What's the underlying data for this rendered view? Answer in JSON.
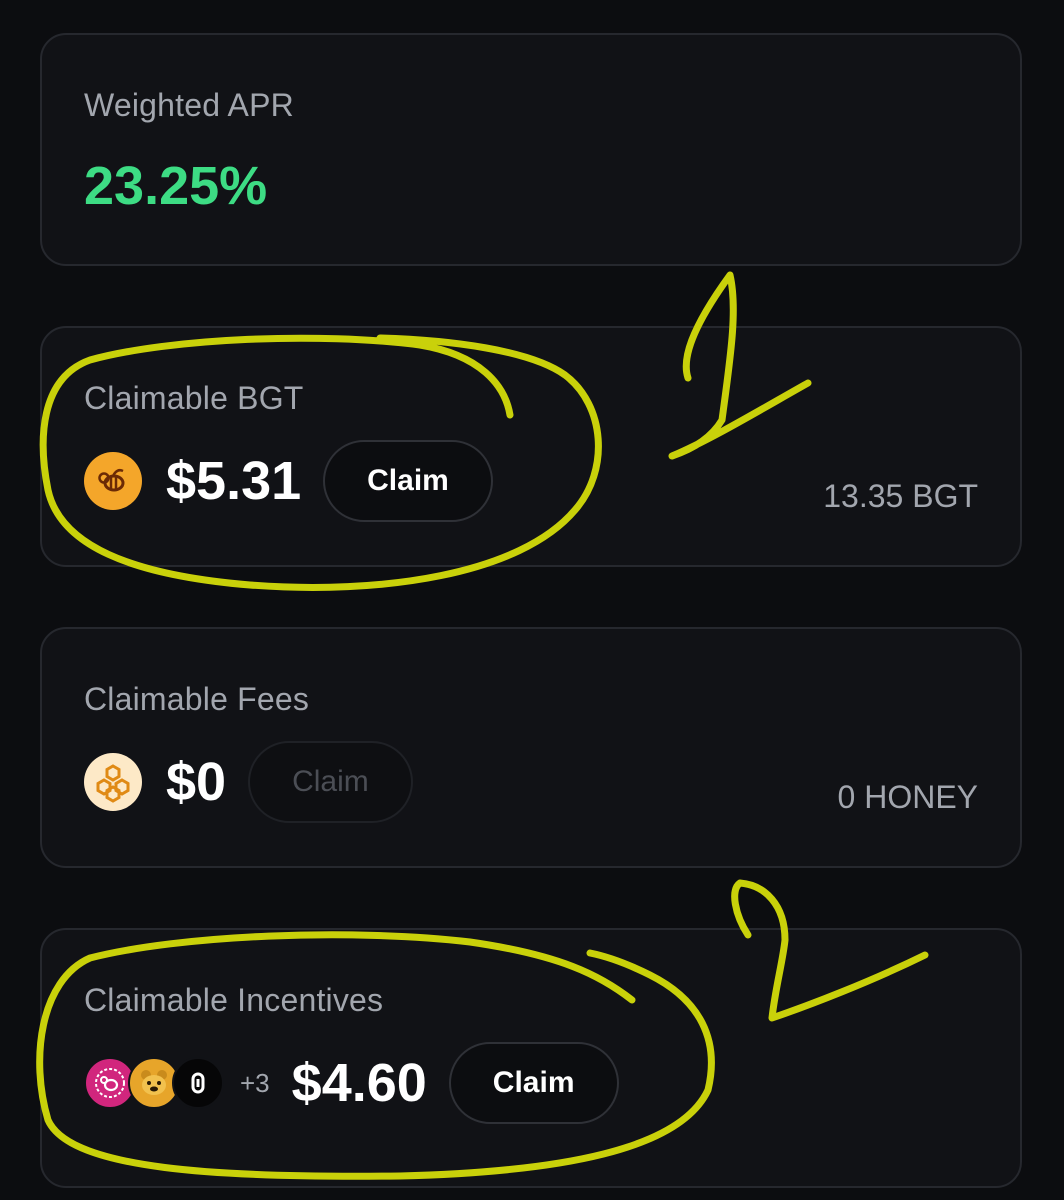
{
  "apr": {
    "label": "Weighted APR",
    "value": "23.25%"
  },
  "bgt": {
    "label": "Claimable BGT",
    "icon": "bgt-bee-icon",
    "amount": "$5.31",
    "claim_label": "Claim",
    "balance": "13.35 BGT"
  },
  "fees": {
    "label": "Claimable Fees",
    "icon": "honeycomb-icon",
    "amount": "$0",
    "claim_label": "Claim",
    "claim_enabled": false,
    "balance": "0 HONEY"
  },
  "incentives": {
    "label": "Claimable Incentives",
    "icons": [
      "pink-bee-token-icon",
      "bear-token-icon",
      "black-token-icon"
    ],
    "more_count": "+3",
    "amount": "$4.60",
    "claim_label": "Claim"
  },
  "annotations": {
    "marks": [
      "1",
      "2"
    ],
    "color": "#c9d10a"
  },
  "colors": {
    "background": "#0c0d10",
    "card": "#111216",
    "apr_green": "#3ddc84",
    "muted_text": "#a2a6ae"
  }
}
